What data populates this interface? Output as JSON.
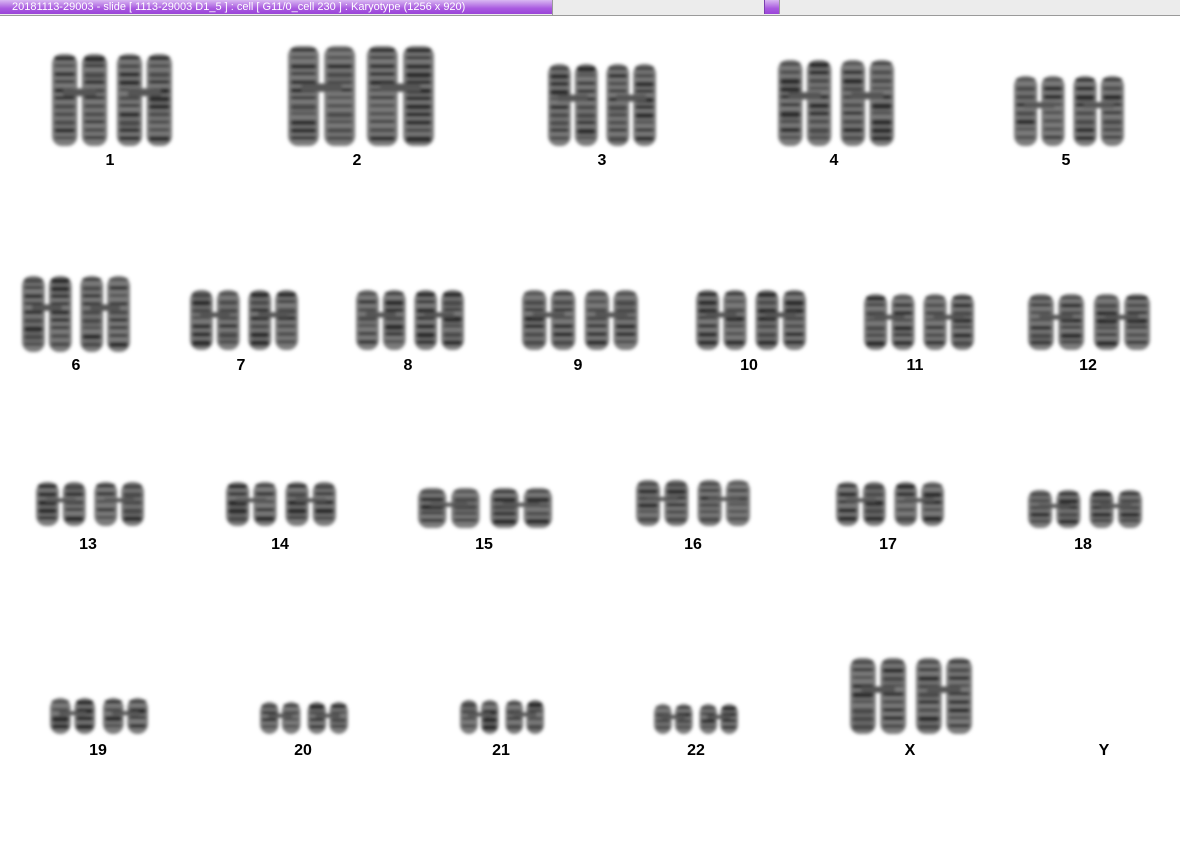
{
  "window": {
    "title": "20181113-29003 - slide [ 1113-29003 D1_5 ] : cell [ G11/0_cell 230 ] : Karyotype  (1256 x 920)"
  },
  "karyotype": {
    "chromosomes": [
      {
        "label": "1"
      },
      {
        "label": "2"
      },
      {
        "label": "3"
      },
      {
        "label": "4"
      },
      {
        "label": "5"
      },
      {
        "label": "6"
      },
      {
        "label": "7"
      },
      {
        "label": "8"
      },
      {
        "label": "9"
      },
      {
        "label": "10"
      },
      {
        "label": "11"
      },
      {
        "label": "12"
      },
      {
        "label": "13"
      },
      {
        "label": "14"
      },
      {
        "label": "15"
      },
      {
        "label": "16"
      },
      {
        "label": "17"
      },
      {
        "label": "18"
      },
      {
        "label": "19"
      },
      {
        "label": "20"
      },
      {
        "label": "21"
      },
      {
        "label": "22"
      },
      {
        "label": "X"
      },
      {
        "label": "Y"
      }
    ]
  }
}
